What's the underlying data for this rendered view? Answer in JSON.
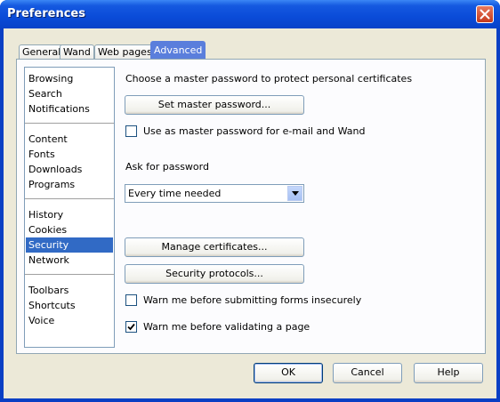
{
  "window": {
    "title": "Preferences"
  },
  "tabs": [
    {
      "label": "General"
    },
    {
      "label": "Wand"
    },
    {
      "label": "Web pages"
    },
    {
      "label": "Advanced",
      "active": true
    }
  ],
  "categories": [
    {
      "label": "Browsing"
    },
    {
      "label": "Search"
    },
    {
      "label": "Notifications"
    },
    {
      "label": "Content"
    },
    {
      "label": "Fonts"
    },
    {
      "label": "Downloads"
    },
    {
      "label": "Programs"
    },
    {
      "label": "History"
    },
    {
      "label": "Cookies"
    },
    {
      "label": "Security",
      "selected": true
    },
    {
      "label": "Network"
    },
    {
      "label": "Toolbars"
    },
    {
      "label": "Shortcuts"
    },
    {
      "label": "Voice"
    }
  ],
  "security": {
    "intro": "Choose a master password to protect personal certificates",
    "set_master_password": "Set master password...",
    "use_master_for_mail": {
      "label": "Use as master password for e-mail and Wand",
      "checked": false
    },
    "ask_for_password_label": "Ask for password",
    "ask_for_password_value": "Every time needed",
    "manage_certificates": "Manage certificates...",
    "security_protocols": "Security protocols...",
    "warn_forms": {
      "label": "Warn me before submitting forms insecurely",
      "checked": false
    },
    "warn_validating": {
      "label": "Warn me before validating a page",
      "checked": true
    }
  },
  "footer": {
    "ok": "OK",
    "cancel": "Cancel",
    "help": "Help"
  }
}
